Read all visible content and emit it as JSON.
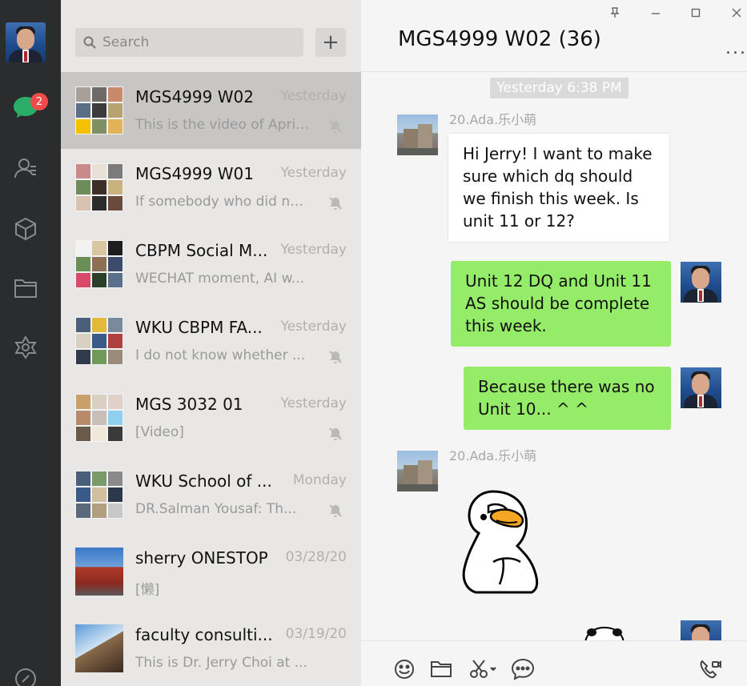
{
  "rail": {
    "unread_badge": "2",
    "icons": [
      "chat-icon",
      "contacts-icon",
      "miniprogram-icon",
      "files-icon",
      "moments-icon",
      "link-icon"
    ]
  },
  "search": {
    "placeholder": "Search"
  },
  "add_button": "+",
  "chats": [
    {
      "name": "MGS4999 W02",
      "time": "Yesterday",
      "preview": "This is the video of April...",
      "muted": true,
      "selected": true
    },
    {
      "name": "MGS4999 W01",
      "time": "Yesterday",
      "preview": "If somebody who did not...",
      "muted": true,
      "selected": false
    },
    {
      "name": "CBPM Social M...",
      "time": "Yesterday",
      "preview": "WECHAT moment, AI w...",
      "muted": false,
      "selected": false
    },
    {
      "name": "WKU CBPM FA...",
      "time": "Yesterday",
      "preview": "I do not know whether ...",
      "muted": true,
      "selected": false
    },
    {
      "name": "MGS 3032 01",
      "time": "Yesterday",
      "preview": "[Video]",
      "muted": true,
      "selected": false
    },
    {
      "name": "WKU School of ...",
      "time": "Monday",
      "preview": "DR.Salman Yousaf:  Th...",
      "muted": true,
      "selected": false
    },
    {
      "name": "sherry ONESTOP",
      "time": "03/28/20",
      "preview": "[懒]",
      "muted": false,
      "selected": false
    },
    {
      "name": "faculty consulti...",
      "time": "03/19/20",
      "preview": "This is Dr. Jerry Choi at ...",
      "muted": false,
      "selected": false
    }
  ],
  "conversation": {
    "title": "MGS4999 W02 (36)",
    "more_label": "...",
    "timestamp": "Yesterday 6:38 PM",
    "messages": [
      {
        "sender": "20.Ada.乐小萌",
        "side": "in",
        "lines": [
          "Hi Jerry! I want to make",
          "sure which dq should",
          "we finish this week. Is",
          "unit 11 or 12?"
        ]
      },
      {
        "sender": "",
        "side": "out",
        "lines": [
          "Unit 12 DQ and Unit 11",
          "AS should be complete",
          "this week."
        ]
      },
      {
        "sender": "",
        "side": "out",
        "lines": [
          "Because there was no",
          "Unit 10... ^ ^"
        ]
      },
      {
        "sender": "20.Ada.乐小萌",
        "side": "in",
        "type": "sticker",
        "sticker": "duck-sticker"
      }
    ]
  },
  "toolbar": {
    "icons": [
      "emoji-icon",
      "folder-icon",
      "scissors-icon",
      "chat-bubble-icon",
      "call-icon"
    ]
  },
  "colors": {
    "rail_bg": "#2b2c2e",
    "list_bg": "#e8e7e6",
    "selected_bg": "#c7c6c5",
    "out_bubble": "#95ec69",
    "in_bubble": "#ffffff",
    "badge": "#f04b4b",
    "accent_chat": "#2aae67"
  }
}
